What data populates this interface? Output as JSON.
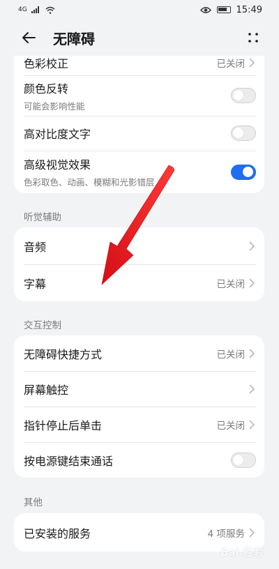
{
  "status_bar": {
    "network": "4G",
    "time": "15:49"
  },
  "header": {
    "title": "无障碍"
  },
  "vision_card": {
    "partial_row": {
      "title": "色彩校正",
      "value": "已关闭"
    },
    "rows": [
      {
        "title": "颜色反转",
        "subtitle": "可能会影响性能",
        "toggle": false
      },
      {
        "title": "高对比度文字",
        "toggle": false
      },
      {
        "title": "高级视觉效果",
        "subtitle": "色彩取色、动画、模糊和光影错层",
        "toggle": true
      }
    ]
  },
  "hearing_section": {
    "label": "听觉辅助",
    "rows": [
      {
        "title": "音频",
        "value": ""
      },
      {
        "title": "字幕",
        "value": "已关闭"
      }
    ]
  },
  "interaction_section": {
    "label": "交互控制",
    "rows": [
      {
        "title": "无障碍快捷方式",
        "value": "已关闭"
      },
      {
        "title": "屏幕触控",
        "value": ""
      },
      {
        "title": "指针停止后单击",
        "value": "已关闭"
      },
      {
        "title": "按电源键结束通话",
        "toggle": false
      }
    ]
  },
  "other_section": {
    "label": "其他",
    "rows": [
      {
        "title": "已安装的服务",
        "value": "4 项服务"
      }
    ]
  },
  "watermark": "Bai 经验",
  "colors": {
    "accent": "#1d6ef0",
    "background": "#f1f3f5",
    "arrow": "#e8141c"
  }
}
